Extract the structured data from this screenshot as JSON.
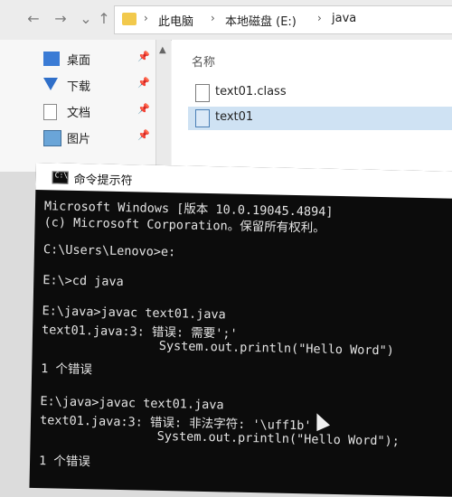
{
  "explorer": {
    "nav": {
      "back": "←",
      "forward": "→",
      "dropdown": "⌄",
      "up": "↑"
    },
    "breadcrumb": [
      "此电脑",
      "本地磁盘 (E:)",
      "java"
    ],
    "separator": "›",
    "sidebar": [
      {
        "label": "桌面",
        "icon": "desktop-icon"
      },
      {
        "label": "下载",
        "icon": "download-icon"
      },
      {
        "label": "文档",
        "icon": "documents-icon"
      },
      {
        "label": "图片",
        "icon": "pictures-icon"
      }
    ],
    "pin_glyph": "📌",
    "files_header": "名称",
    "files": [
      {
        "name": "text01.class",
        "selected": false
      },
      {
        "name": "text01",
        "selected": true
      }
    ]
  },
  "cmd": {
    "title": "命令提示符",
    "icon_text": "C:\\",
    "lines": [
      "Microsoft Windows [版本 10.0.19045.4894]",
      "(c) Microsoft Corporation。保留所有权利。",
      "",
      "C:\\Users\\Lenovo>e:",
      "",
      "E:\\>cd java",
      "",
      "E:\\java>javac text01.java",
      "text01.java:3: 错误: 需要';'",
      "                System.out.println(\"Hello Word\")",
      "",
      "1 个错误",
      "",
      "E:\\java>javac text01.java",
      "text01.java:3: 错误: 非法字符: '\\uff1b'",
      "                System.out.println(\"Hello Word\");",
      "",
      "1 个错误"
    ]
  }
}
